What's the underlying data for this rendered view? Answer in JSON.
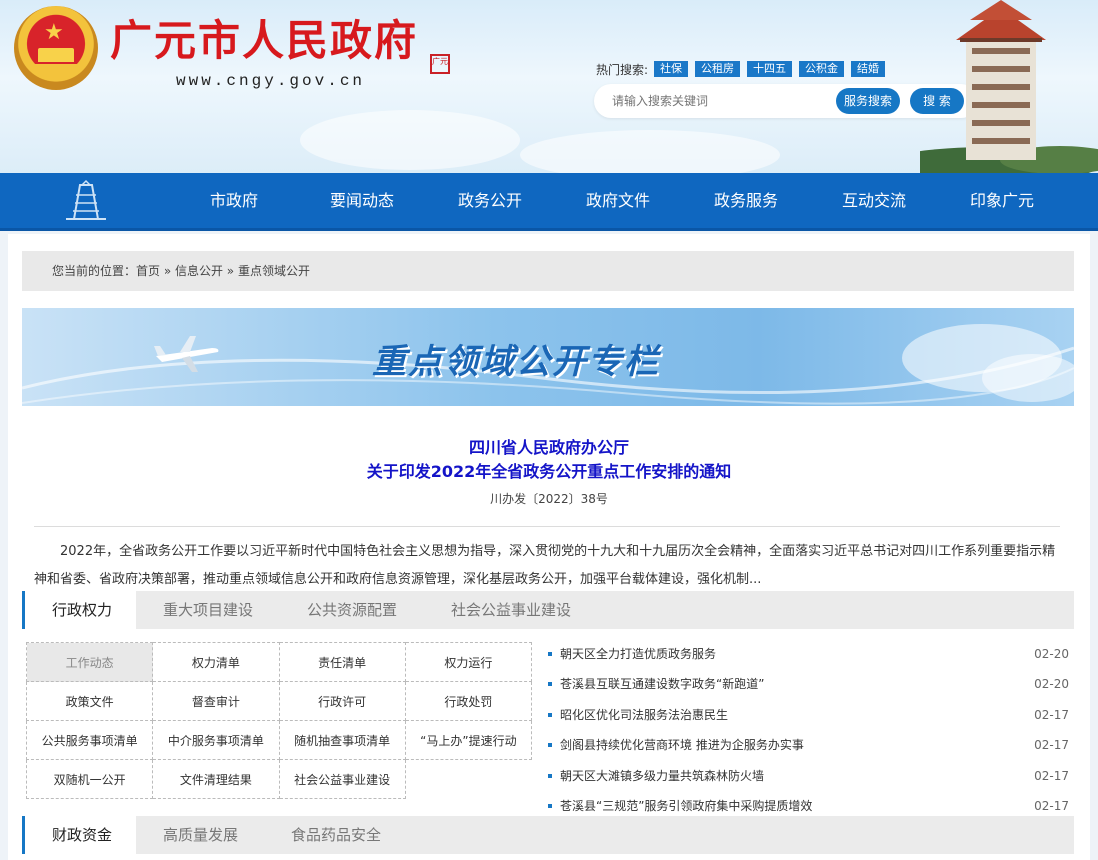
{
  "header": {
    "site_title": "广元市人民政府",
    "site_url": "www.cngy.gov.cn",
    "hot_label": "热门搜索:",
    "hot_tags": [
      "社保",
      "公租房",
      "十四五",
      "公积金",
      "结婚"
    ],
    "search_placeholder": "请输入搜索关键词",
    "service_search": "服务搜索",
    "search": "搜 索"
  },
  "nav": {
    "items": [
      "市政府",
      "要闻动态",
      "政务公开",
      "政府文件",
      "政务服务",
      "互动交流",
      "印象广元"
    ]
  },
  "breadcrumb": "您当前的位置：首页 » 信息公开 » 重点领域公开",
  "banner_title": "重点领域公开专栏",
  "doc": {
    "title_line1": "四川省人民政府办公厅",
    "title_line2": "关于印发2022年全省政务公开重点工作安排的通知",
    "number": "川办发〔2022〕38号",
    "summary": "2022年，全省政务公开工作要以习近平新时代中国特色社会主义思想为指导，深入贯彻党的十九大和十九届历次全会精神，全面落实习近平总书记对四川工作系列重要指示精神和省委、省政府决策部署，推动重点领域信息公开和政府信息资源管理，深化基层政务公开，加强平台载体建设，强化机制..."
  },
  "tabs1": [
    "行政权力",
    "重大项目建设",
    "公共资源配置",
    "社会公益事业建设"
  ],
  "grid": [
    [
      "工作动态",
      "权力清单",
      "责任清单",
      "权力运行"
    ],
    [
      "政策文件",
      "督查审计",
      "行政许可",
      "行政处罚"
    ],
    [
      "公共服务事项清单",
      "中介服务事项清单",
      "随机抽查事项清单",
      "“马上办”提速行动"
    ],
    [
      "双随机一公开",
      "文件清理结果",
      "社会公益事业建设",
      ""
    ]
  ],
  "news": [
    {
      "title": "朝天区全力打造优质政务服务",
      "date": "02-20"
    },
    {
      "title": "苍溪县互联互通建设数字政务“新跑道”",
      "date": "02-20"
    },
    {
      "title": "昭化区优化司法服务法治惠民生",
      "date": "02-17"
    },
    {
      "title": "剑阁县持续优化营商环境 推进为企服务办实事",
      "date": "02-17"
    },
    {
      "title": "朝天区大滩镇多级力量共筑森林防火墙",
      "date": "02-17"
    },
    {
      "title": "苍溪县“三规范”服务引领政府集中采购提质增效",
      "date": "02-17"
    }
  ],
  "tabs2": [
    "财政资金",
    "高质量发展",
    "食品药品安全"
  ]
}
